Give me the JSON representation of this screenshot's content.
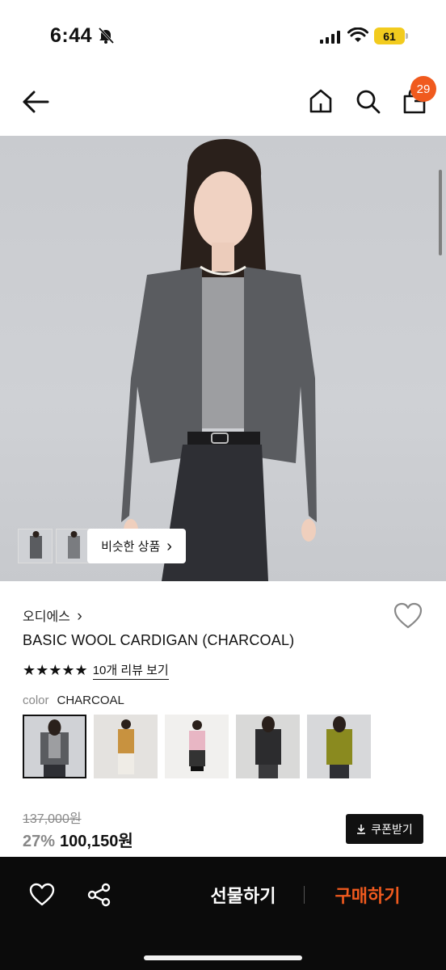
{
  "status_bar": {
    "time": "6:44",
    "battery": "61"
  },
  "nav": {
    "cart_count": "29",
    "icons": [
      "back-arrow-icon",
      "home-icon",
      "search-icon",
      "cart-icon"
    ]
  },
  "hero": {
    "similar_label": "비슷한 상품",
    "similar_chevron": "›"
  },
  "product": {
    "brand": "오디에스",
    "brand_chevron": "›",
    "title": "BASIC WOOL CARDIGAN (CHARCOAL)",
    "stars": "★★★★★",
    "rating_value": 5,
    "review_link": "10개 리뷰 보기",
    "color_label": "color",
    "color_value": "CHARCOAL",
    "swatch_colors": [
      "#4a4c50",
      "#c8923f",
      "#e8b6c4",
      "#2c2c2e",
      "#8a8a1f"
    ],
    "old_price": "137,000원",
    "discount": "27%",
    "price": "100,150원",
    "coupon_label": "쿠폰받기"
  },
  "bottom_bar": {
    "gift_label": "선물하기",
    "buy_label": "구매하기",
    "buy_color": "#f05a1e"
  }
}
